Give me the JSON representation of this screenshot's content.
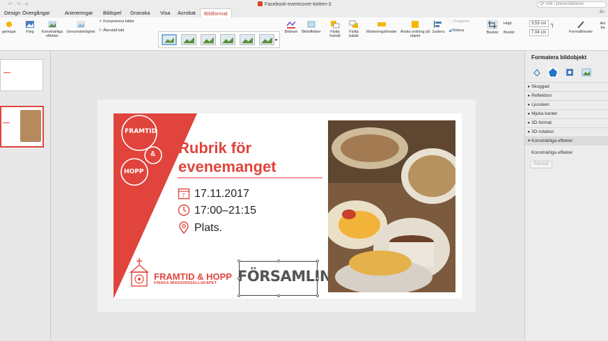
{
  "window": {
    "quick_access": "↶ · ↷ · ≡",
    "title": "Facebook-eventcover-botten-3",
    "search_placeholder": "Q• Sök i presentationen"
  },
  "tabs": [
    {
      "label": "Design"
    },
    {
      "label": "Övergångar"
    },
    {
      "label": "Animeringar"
    },
    {
      "label": "Bildspel"
    },
    {
      "label": "Granska"
    },
    {
      "label": "Visa"
    },
    {
      "label": "Acrobat"
    },
    {
      "label": "Bildformat",
      "active": true
    }
  ],
  "share_label": "å+",
  "ribbon": {
    "korrigeringar": "geringar",
    "farg": "Färg",
    "konstnarliga": "Konstnärliga effekter",
    "genomskinlighet": "Genomskinlighet",
    "komprimera": "Komprimera bilder",
    "aterstall": "Återställ bild",
    "bildram": "Bildram",
    "bildeffekter": "Bildeffekter",
    "flytta_framat": "Flytta framåt",
    "flytta_bakat": "Flytta bakåt",
    "markeringsfonster": "Markeringsfönster",
    "andra_ordning": "Ändra ordning på objekt",
    "justera": "Justera",
    "gruppera": "Gruppera",
    "rotera": "Rotera",
    "beskar": "Beskär",
    "hojd_label": "Höjd:",
    "hojd_value": "3,53 cm",
    "bredd_label": "Bredd:",
    "bredd_value": "7,04 cm",
    "formatfonster": "Formatfönster",
    "ani": "Ani ba"
  },
  "slide": {
    "badge_top": "FRAMTID",
    "badge_amp": "&",
    "badge_bottom": "HOPP",
    "heading_line1": "Rubrik för",
    "heading_line2": "evenemanget",
    "date": "17.11.2017",
    "time": "17:00–21:15",
    "place": "Plats.",
    "logo_name": "FRAMTID & HOPP",
    "logo_sub": "FINSKA MISSIONSSÄLLSKAPET",
    "forsamling": "FÖRSAMLING",
    "calendar_day": "7"
  },
  "format_panel": {
    "title": "Formatera bildobjekt",
    "sections": [
      {
        "label": "▸ Skuggad"
      },
      {
        "label": "▸ Reflektion"
      },
      {
        "label": "▸ Ljussken"
      },
      {
        "label": "▸ Mjuka kanter"
      },
      {
        "label": "▸ 3D-format"
      },
      {
        "label": "▸ 3D-rotation"
      },
      {
        "label": "▾ Konstnärliga effekter",
        "open": true
      }
    ],
    "effects_label": "Konstnärliga effekter",
    "reset_label": "Återställ"
  },
  "colors": {
    "accent": "#e0443c",
    "tab_active": "#c0392b"
  }
}
